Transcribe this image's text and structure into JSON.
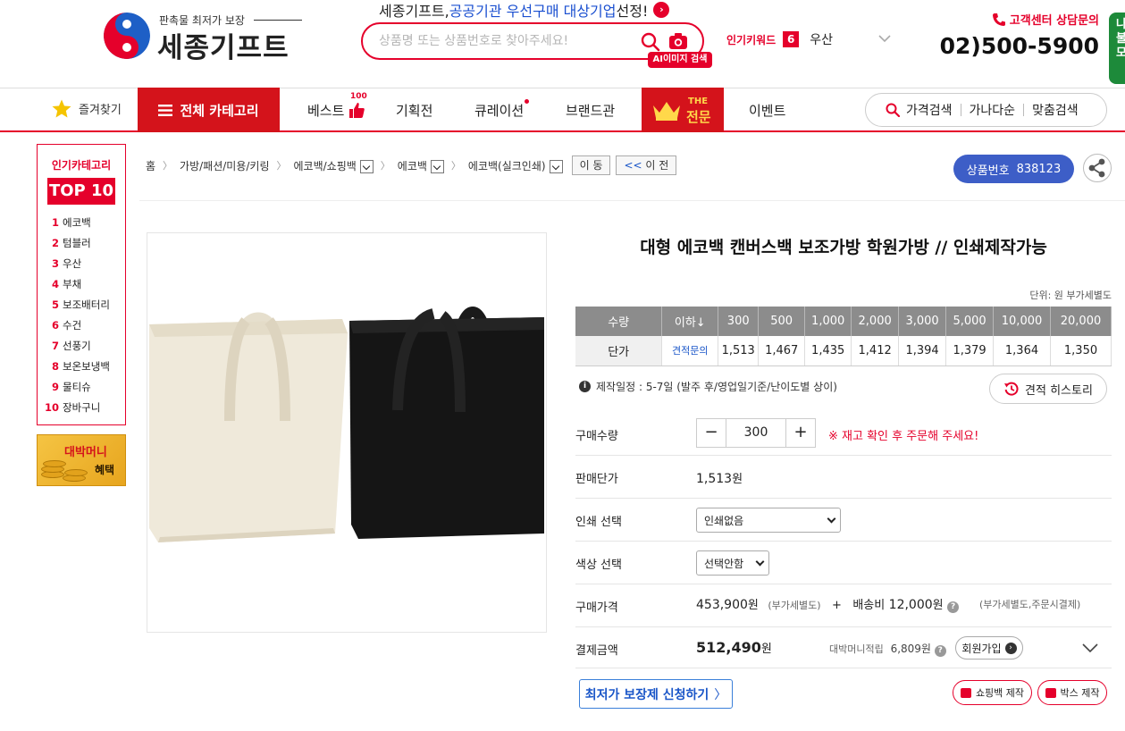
{
  "header": {
    "logo_sub": "판촉물 최저가 보장",
    "logo_main": "세종기프트",
    "promo_prefix": "세종기프트, ",
    "promo_highlight": "공공기관 우선구매 대상기업",
    "promo_suffix": " 선정!",
    "search_placeholder": "상품명 또는 상품번호로 찾아주세요!",
    "ai_badge": "AI이미지 검색",
    "keyword_label": "인기키워드",
    "keyword_rank": "6",
    "keyword_word": "우산",
    "cs_label": "고객센터 상담문의",
    "cs_phone": "02)500-5900",
    "side_tab": "나\n불\n모"
  },
  "nav": {
    "favorites": "즐겨찾기",
    "all_category": "전체 카테고리",
    "items": [
      {
        "label": "베스트",
        "badge": "100"
      },
      {
        "label": "기획전"
      },
      {
        "label": "큐레이션"
      },
      {
        "label": "브랜드관"
      },
      {
        "label": "이벤트"
      }
    ],
    "special_the": "THE",
    "special_main": "전문",
    "price_search": "가격검색",
    "alpha_search": "가나다순",
    "custom_search": "맞춤검색"
  },
  "popular": {
    "head": "인기카테고리",
    "top": "TOP 10",
    "items": [
      {
        "rank": "1",
        "label": "에코백"
      },
      {
        "rank": "2",
        "label": "텀블러"
      },
      {
        "rank": "3",
        "label": "우산"
      },
      {
        "rank": "4",
        "label": "부채"
      },
      {
        "rank": "5",
        "label": "보조배터리"
      },
      {
        "rank": "6",
        "label": "수건"
      },
      {
        "rank": "7",
        "label": "선풍기"
      },
      {
        "rank": "8",
        "label": "보온보냉백"
      },
      {
        "rank": "9",
        "label": "물티슈"
      },
      {
        "rank": "10",
        "label": "장바구니"
      }
    ],
    "banner_line1": "대박머니",
    "banner_line2": "혜택"
  },
  "breadcrumb": {
    "home": "홈",
    "level1": "가방/패션/미용/키링",
    "level2": "에코백/쇼핑백",
    "level3": "에코백",
    "level4": "에코백(실크인쇄)",
    "move_btn": "이 동",
    "prev_btn": "이 전",
    "prev_icon": "<<"
  },
  "product": {
    "number_label": "상품번호",
    "number": "838123",
    "title": "대형 에코백 캔버스백 보조가방 학원가방 // 인쇄제작가능",
    "unit_note": "단위: 원 부가세별도",
    "price_table": {
      "qty_label": "수량",
      "price_label": "단가",
      "quantities": [
        "이하↓",
        "300",
        "500",
        "1,000",
        "2,000",
        "3,000",
        "5,000",
        "10,000",
        "20,000"
      ],
      "prices": [
        "견적문의",
        "1,513",
        "1,467",
        "1,435",
        "1,412",
        "1,394",
        "1,379",
        "1,364",
        "1,350"
      ]
    },
    "production_period": "제작일정 : 5-7일 (발주 후/영업일기준/난이도별 상이)",
    "history_btn": "견적 히스토리",
    "qty_label": "구매수량",
    "qty_value": "300",
    "stock_note": "※ 재고 확인 후 주문해 주세요!",
    "unit_price_label": "판매단가",
    "unit_price": "1,513",
    "won": "원",
    "print_label": "인쇄 선택",
    "print_value": "인쇄없음",
    "color_label": "색상 선택",
    "color_value": "선택안함",
    "purchase_label": "구매가격",
    "purchase_price": "453,900",
    "vat_excluded": "(부가세별도)",
    "plus": "+",
    "shipping_label": "배송비",
    "shipping_price": "12,000",
    "shipping_note": "(부가세별도,주문시결제)",
    "total_label": "결제금액",
    "total_price": "512,490",
    "money_label": "대박머니적립",
    "money_value": "6,809",
    "member_btn": "회원가입",
    "lowest_btn": "최저가 보장제 신청하기",
    "shopping_bag_btn": "쇼핑백 제작",
    "box_btn": "박스 제작"
  },
  "colors": {
    "brand_red": "#e5002b",
    "nav_red": "#d4131b",
    "badge_blue": "#3d5ec7",
    "link_blue": "#1a56c8"
  }
}
